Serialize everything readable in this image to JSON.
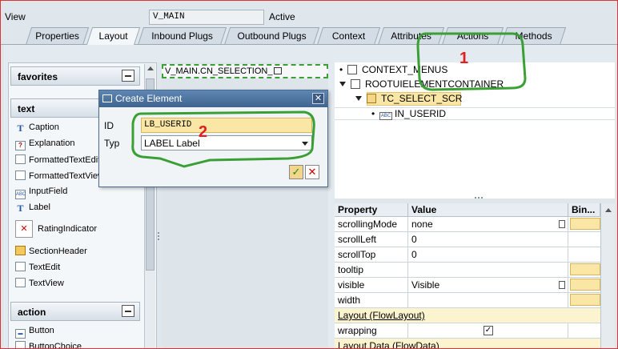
{
  "header": {
    "view_label": "View",
    "view_value": "V_MAIN",
    "status": "Active"
  },
  "tabs": [
    {
      "label": "Properties"
    },
    {
      "label": "Layout",
      "active": true
    },
    {
      "label": "Inbound Plugs"
    },
    {
      "label": "Outbound Plugs"
    },
    {
      "label": "Context"
    },
    {
      "label": "Attributes"
    },
    {
      "label": "Actions"
    },
    {
      "label": "Methods"
    }
  ],
  "palette": {
    "sections": {
      "favorites": "favorites",
      "text": "text",
      "action": "action"
    },
    "text_items": [
      "Caption",
      "Explanation",
      "FormattedTextEdit",
      "FormattedTextView",
      "InputField",
      "Label",
      "RatingIndicator",
      "SectionHeader",
      "TextEdit",
      "TextView"
    ],
    "action_items": [
      "Button",
      "ButtonChoice"
    ]
  },
  "canvas": {
    "selection_label": "V_MAIN.CN_SELECTION_"
  },
  "tree": {
    "items": [
      {
        "label": "CONTEXT_MENUS"
      },
      {
        "label": "ROOTUIELEMENTCONTAINER"
      },
      {
        "label": "TC_SELECT_SCR"
      },
      {
        "label": "IN_USERID"
      }
    ]
  },
  "properties": {
    "headers": {
      "property": "Property",
      "value": "Value",
      "binding": "Bin..."
    },
    "rows": [
      {
        "property": "scrollingMode",
        "value": "none"
      },
      {
        "property": "scrollLeft",
        "value": "0"
      },
      {
        "property": "scrollTop",
        "value": "0"
      },
      {
        "property": "tooltip",
        "value": ""
      },
      {
        "property": "visible",
        "value": "Visible"
      },
      {
        "property": "width",
        "value": ""
      }
    ],
    "category_layout": "Layout (FlowLayout)",
    "wrapping_label": "wrapping",
    "wrapping_checked": "✓",
    "category_layout_data": "Layout Data (FlowData)"
  },
  "dialog": {
    "title": "Create Element",
    "close_glyph": "✕",
    "id_label": "ID",
    "id_value": "LB_USERID",
    "type_label": "Typ",
    "type_value": "LABEL Label",
    "ok_glyph": "✓",
    "cancel_glyph": "✕"
  },
  "annotations": {
    "marker_1": "1",
    "marker_2": "2",
    "color": "#3aa035",
    "number_color": "#e02020"
  }
}
